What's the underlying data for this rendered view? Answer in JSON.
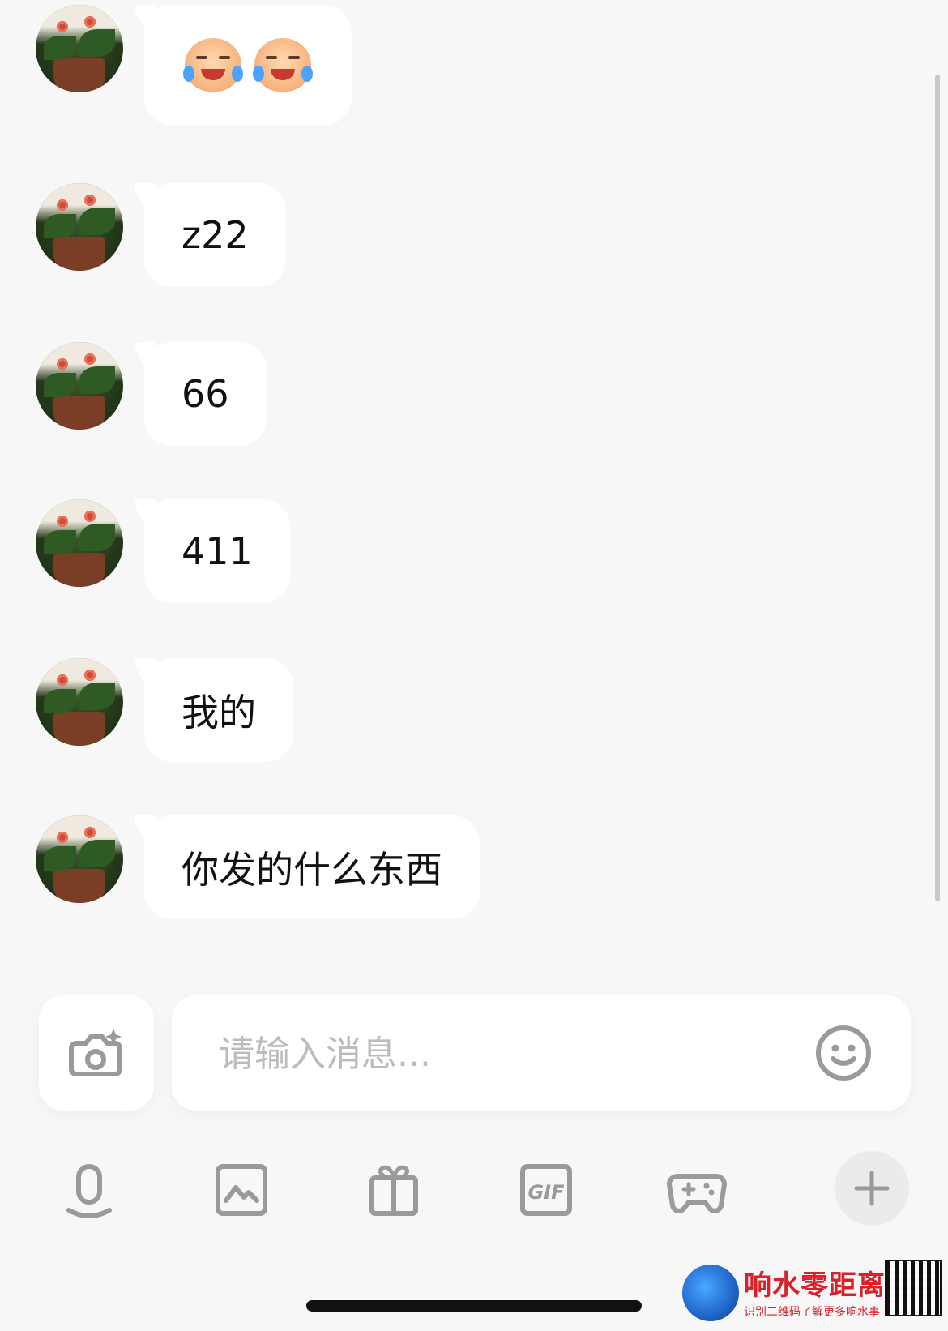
{
  "messages": [
    {
      "type": "emoji",
      "emoji": [
        "tears-of-joy-emoji",
        "tears-of-joy-emoji"
      ]
    },
    {
      "type": "text",
      "text": "z22"
    },
    {
      "type": "text",
      "text": "66"
    },
    {
      "type": "text",
      "text": "411"
    },
    {
      "type": "text",
      "text": "我的"
    },
    {
      "type": "text",
      "text": "你发的什么东西"
    }
  ],
  "composer": {
    "placeholder": "请输入消息...",
    "camera_icon": "camera-sparkle-icon",
    "emoji_icon": "smiley-icon"
  },
  "toolbar": {
    "items": [
      "microphone-icon",
      "image-icon",
      "gift-icon",
      "gif-icon",
      "gamepad-icon",
      "plus-icon"
    ]
  },
  "watermark": {
    "title": "响水零距离",
    "subtitle": "识别二维码了解更多响水事"
  },
  "colors": {
    "background": "#f7f7f7",
    "bubble": "#ffffff",
    "icon": "#9a9a9a",
    "placeholder": "#bcbcbc"
  }
}
